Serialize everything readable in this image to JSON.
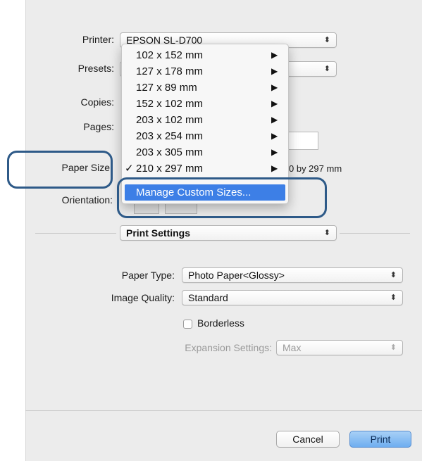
{
  "printer": {
    "label": "Printer:",
    "value": "EPSON SL-D700"
  },
  "presets": {
    "label": "Presets:"
  },
  "copies": {
    "label": "Copies:"
  },
  "pages": {
    "label": "Pages:"
  },
  "paper_size": {
    "label": "Paper Size",
    "size_suffix": "0 by 297 mm"
  },
  "orientation": {
    "label": "Orientation:"
  },
  "paper_size_menu": {
    "items": [
      {
        "label": "102 x 152 mm",
        "checked": false
      },
      {
        "label": "127 x 178 mm",
        "checked": false
      },
      {
        "label": "127 x 89 mm",
        "checked": false
      },
      {
        "label": "152 x 102 mm",
        "checked": false
      },
      {
        "label": "203 x 102 mm",
        "checked": false
      },
      {
        "label": "203 x 254 mm",
        "checked": false
      },
      {
        "label": "203 x 305 mm",
        "checked": false
      },
      {
        "label": "210 x 297 mm",
        "checked": true
      }
    ],
    "submenu_glyph": "▶",
    "check_glyph": "✓",
    "manage_custom": "Manage Custom Sizes..."
  },
  "section": {
    "value": "Print Settings"
  },
  "paper_type": {
    "label": "Paper Type:",
    "value": "Photo Paper<Glossy>"
  },
  "image_quality": {
    "label": "Image Quality:",
    "value": "Standard"
  },
  "borderless": {
    "label": "Borderless"
  },
  "expansion": {
    "label": "Expansion Settings:",
    "value": "Max"
  },
  "buttons": {
    "cancel": "Cancel",
    "print": "Print"
  },
  "popup_glyph": "⬍",
  "colors": {
    "selection": "#3d7fe6",
    "annotation": "#2e5a88",
    "print_button": "#6eaef0"
  }
}
